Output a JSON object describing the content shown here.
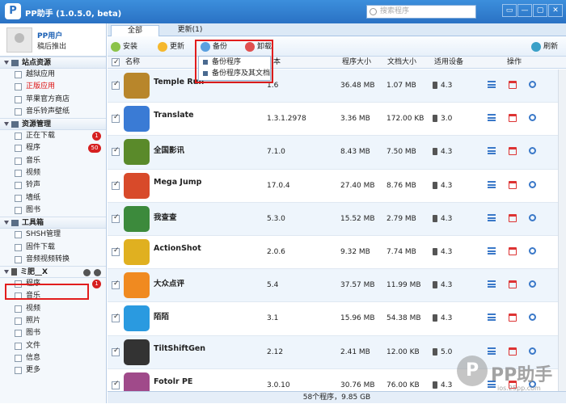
{
  "window": {
    "title": "PP助手 (1.0.5.0, beta)",
    "logo": "P",
    "search_placeholder": "搜索程序",
    "buttons": [
      "▭",
      "—",
      "▢",
      "✕"
    ]
  },
  "user": {
    "name": "PP用户",
    "status": "稿后推出"
  },
  "sidebar": {
    "sections": [
      {
        "title": "站点资源",
        "items": [
          {
            "label": "越狱应用"
          },
          {
            "label": "正版应用",
            "red": true
          },
          {
            "label": "苹果官方商店"
          },
          {
            "label": "音乐铃声壁纸"
          }
        ]
      },
      {
        "title": "资源管理",
        "items": [
          {
            "label": "正在下载",
            "badge": "1"
          },
          {
            "label": "程序",
            "badge": "50"
          },
          {
            "label": "音乐"
          },
          {
            "label": "视频"
          },
          {
            "label": "铃声"
          },
          {
            "label": "墙纸"
          },
          {
            "label": "图书"
          }
        ]
      },
      {
        "title": "工具箱",
        "items": [
          {
            "label": "SHSH管理"
          },
          {
            "label": "固件下载"
          },
          {
            "label": "音频视频转换"
          }
        ]
      }
    ],
    "device": {
      "title": "ミ肥__X",
      "items": [
        {
          "label": "程序",
          "badge": "1"
        },
        {
          "label": "音乐"
        },
        {
          "label": "视频"
        },
        {
          "label": "照片"
        },
        {
          "label": "图书"
        },
        {
          "label": "文件"
        },
        {
          "label": "信息"
        },
        {
          "label": "更多"
        }
      ]
    }
  },
  "tabs": [
    {
      "label": "全部"
    },
    {
      "label": "更新(1)"
    }
  ],
  "toolbar": {
    "install": "安装",
    "update": "更新",
    "backup": "备份",
    "uninstall": "卸载",
    "refresh": "刷新"
  },
  "dropdown": [
    "备份程序",
    "备份程序及其文档"
  ],
  "columns": {
    "name": "名称",
    "version": "本",
    "size": "程序大小",
    "docsize": "文档大小",
    "device": "适用设备",
    "ops": "操作"
  },
  "apps": [
    {
      "name": "Temple Run",
      "version": "1.6",
      "size": "36.48 MB",
      "doc": "1.07 MB",
      "dev": "4.3",
      "color": "#b8862b"
    },
    {
      "name": "Translate",
      "version": "1.3.1.2978",
      "size": "3.36 MB",
      "doc": "172.00 KB",
      "dev": "3.0",
      "color": "#3a7bd5"
    },
    {
      "name": "全国影讯",
      "version": "7.1.0",
      "size": "8.43 MB",
      "doc": "7.50 MB",
      "dev": "4.3",
      "color": "#5a8a2a"
    },
    {
      "name": "Mega Jump",
      "version": "17.0.4",
      "size": "27.40 MB",
      "doc": "8.76 MB",
      "dev": "4.3",
      "color": "#d84a2a"
    },
    {
      "name": "我查查",
      "version": "5.3.0",
      "size": "15.52 MB",
      "doc": "2.79 MB",
      "dev": "4.3",
      "color": "#3c8a3c"
    },
    {
      "name": "ActionShot",
      "version": "2.0.6",
      "size": "9.32 MB",
      "doc": "7.74 MB",
      "dev": "4.3",
      "color": "#e0b020"
    },
    {
      "name": "大众点评",
      "version": "5.4",
      "size": "37.57 MB",
      "doc": "11.99 MB",
      "dev": "4.3",
      "color": "#f08a20"
    },
    {
      "name": "陌陌",
      "version": "3.1",
      "size": "15.96 MB",
      "doc": "54.38 MB",
      "dev": "4.3",
      "color": "#2a9ae0"
    },
    {
      "name": "TiltShiftGen",
      "version": "2.12",
      "size": "2.41 MB",
      "doc": "12.00 KB",
      "dev": "5.0",
      "color": "#333333"
    },
    {
      "name": "Fotolr PE",
      "version": "3.0.10",
      "size": "30.76 MB",
      "doc": "76.00 KB",
      "dev": "4.3",
      "color": "#a04a8a"
    }
  ],
  "status": "58个程序，9.85 GB",
  "watermark": {
    "text": "PP助手",
    "sub": "ios.25pp.com"
  }
}
